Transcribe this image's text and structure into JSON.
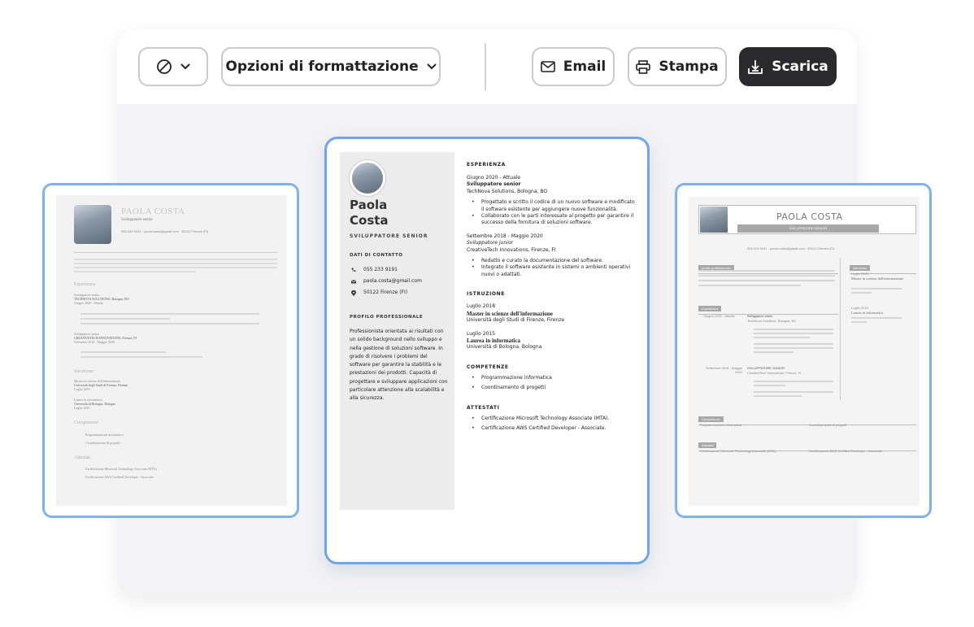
{
  "toolbar": {
    "no_style_label": "",
    "format_options_label": "Opzioni di formattazione",
    "email_label": "Email",
    "print_label": "Stampa",
    "download_label": "Scarica"
  },
  "icons": {
    "no_style": "slash-circle-icon",
    "chevron": "chevron-down-icon",
    "email": "mail-icon",
    "print": "printer-icon",
    "download": "download-icon"
  },
  "colors": {
    "accent_border": "#6fa6e8",
    "download_bg": "#2a2a2c",
    "panel_bg": "#f3f3f5"
  },
  "resume_main": {
    "first_name": "Paola",
    "last_name": "Costa",
    "role": "SVILUPPATORE SENIOR",
    "contact_heading": "DATI DI CONTATTO",
    "phone": "055 233 9191",
    "email": "paola.costa@gmail.com",
    "address": "50122 Firenze (FI)",
    "profile_heading": "PROFILO PROFESSIONALE",
    "profile_text": "Professionista orientata ai risultati con un solido background nello sviluppo e nella gestione di soluzioni software. In grado di risolvere i problemi del software per garantire la stabilità e le prestazioni dei prodotti. Capacità di progettare e sviluppare applicazioni con particolare attenzione alla scalabilità e alla sicurezza.",
    "experience_heading": "ESPERIENZA",
    "experience": [
      {
        "dates": "Giugno 2020 - Attuale",
        "title": "Sviluppatore senior",
        "company": "TechNova Solutions, Bologna, BO",
        "bullets": [
          "Progettato e scritto il codice di un nuovo software e modificato il software esistente per aggiungere nuove funzionalità.",
          "Collaborato con le parti interessate al progetto per garantire il successo della fornitura di soluzioni software."
        ]
      },
      {
        "dates": "Settembre 2018 - Maggio 2020",
        "title": "Sviluppatore junior",
        "company": "CreativeTech Innovations, Firenze, FI",
        "bullets": [
          "Redatto e curato la documentazione del software.",
          "Integrato il software esistente in sistemi o ambienti operativi nuovi o adattati."
        ]
      }
    ],
    "education_heading": "ISTRUZIONE",
    "education": [
      {
        "date": "Luglio 2018",
        "degree": "Master in scienze dell'informazione",
        "school": "Università degli Studi di Firenze, Firenze"
      },
      {
        "date": "Luglio 2015",
        "degree": "Laurea in informatica",
        "school": "Università di Bologna, Bologna"
      }
    ],
    "skills_heading": "COMPETENZE",
    "skills": [
      "Programmazione informatica",
      "Coordinamento di progetti"
    ],
    "certs_heading": "ATTESTATI",
    "certs": [
      "Certificazione Microsoft Technology Associate (MTA).",
      "Certificazione AWS Certified Developer - Associate."
    ]
  },
  "resume_left": {
    "name": "PAOLA COSTA",
    "role": "Sviluppatore senior",
    "contact_line": "055 233 9191 · paola.costa@gmail.com · 50122 Firenze (FI)",
    "experience_heading": "Esperienza",
    "education_heading": "Istruzione",
    "skills_heading": "Competenze",
    "certs_heading": "Attestati",
    "job1_title": "Sviluppatore senior",
    "job1_company": "TECHNOVA SOLUTIONS, Bologna, BO",
    "job1_dates": "Giugno 2020 - Attuale",
    "job2_title": "Sviluppatore junior",
    "job2_company": "CREATIVETECH INNOVATIONS, Firenze, FI",
    "job2_dates": "Settembre 2018 - Maggio 2020",
    "edu1_degree": "Master in scienze dell'informazione",
    "edu1_school": "Università degli Studi di Firenze, Firenze",
    "edu1_date": "Luglio 2018",
    "edu2_degree": "Laurea in informatica",
    "edu2_school": "Università di Bologna, Bologna",
    "edu2_date": "Luglio 2015",
    "skill1": "Programmazione informatica",
    "skill2": "Coordinamento di progetti",
    "cert1": "Certificazione Microsoft Technology Associate (MTA).",
    "cert2": "Certificazione AWS Certified Developer - Associate."
  },
  "resume_right": {
    "name": "PAOLA COSTA",
    "role": "SVILUPPATORE SENIOR",
    "contact_line": "055 233 9191 · paola.costa@gmail.com · 50122 Firenze (FI)",
    "profile_heading": "profilo professionale",
    "experience_heading": "Esperienza",
    "education_heading": "Istruzione",
    "skills_heading": "Competenze",
    "certs_heading": "Attestati",
    "job1_dates": "Giugno 2020 - Attuale",
    "job1_title": "Sviluppatore senior",
    "job1_company": "TechNova Solutions, Bologna, BO",
    "job2_dates": "Settembre 2018 - Maggio 2020",
    "job2_title": "SVILUPPATORE JUNIOR",
    "job2_company": "CreativeTech Innovations, Firenze, FI",
    "edu1_date": "Luglio 2018",
    "edu1_degree": "Master in scienze dell'informazione",
    "edu2_date": "Luglio 2015",
    "edu2_degree": "Laurea in informatica",
    "skill1": "Programmazione informatica",
    "skill2": "Coordinamento di progetti",
    "cert1": "Certificazione Microsoft Technology Associate (MTA).",
    "cert2": "Certificazione AWS Certified Developer - Associate."
  }
}
